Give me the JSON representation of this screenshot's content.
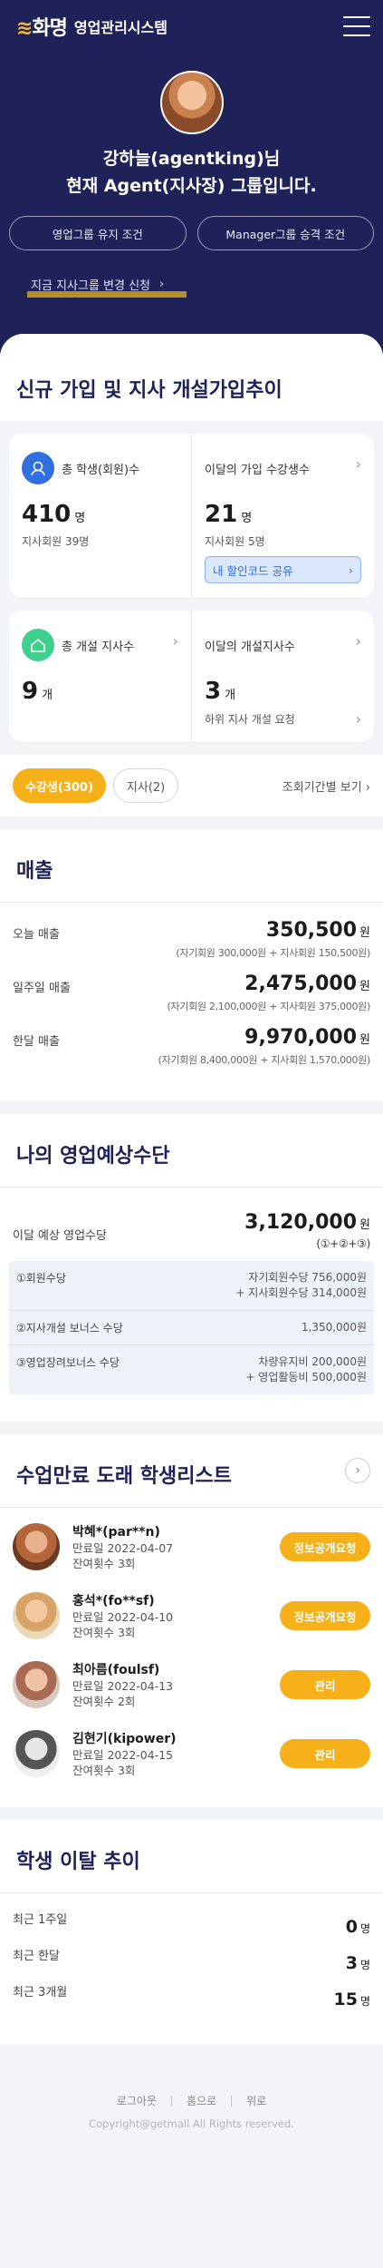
{
  "header": {
    "logo_text": "영업관리시스템",
    "logo_mark": "화명",
    "profile_name": "강하늘(agentking)님",
    "profile_group": "현재 Agent(지사장) 그룹입니다.",
    "btn_keep_condition": "영업그룹 유지 조건",
    "btn_manager_condition": "Manager그룹 승격 조건",
    "change_request": "지금 지사그룹 변경 신청"
  },
  "signup": {
    "title": "신규 가입 및 지사 개설가입추이",
    "total_students_label": "총 학생(회원)수",
    "total_students_value": "410",
    "total_students_unit": "명",
    "total_students_sub": "지사회원 39명",
    "month_join_label": "이달의 가입 수강생수",
    "month_join_value": "21",
    "month_join_unit": "명",
    "month_join_sub": "지사회원 5명",
    "share_btn": "내 할인코드 공유",
    "total_branch_label": "총 개설 지사수",
    "total_branch_value": "9",
    "total_branch_unit": "개",
    "month_branch_label": "이달의 개설지사수",
    "month_branch_value": "3",
    "month_branch_unit": "개",
    "month_branch_sub": "하위 지사 개설 요청",
    "filter_students": "수강생(300)",
    "filter_branch": "지사(2)",
    "period_link": "조회기간별 보기"
  },
  "sales": {
    "title": "매출",
    "rows": [
      {
        "label": "오늘 매출",
        "amount": "350,500",
        "unit": "원",
        "breakdown": "(자기회원 300,000원 + 지사회원 150,500원)"
      },
      {
        "label": "일주일 매출",
        "amount": "2,475,000",
        "unit": "원",
        "breakdown": "(자기회원 2,100,000원 + 지사회원 375,000원)"
      },
      {
        "label": "한달 매출",
        "amount": "9,970,000",
        "unit": "원",
        "breakdown": "(자기회원 8,400,000원 + 지사회원 1,570,000원)"
      }
    ]
  },
  "forecast": {
    "title": "나의 영업예상수단",
    "label": "이달 예상 영업수당",
    "amount": "3,120,000",
    "unit": "원",
    "formula": "(①+②+③)",
    "items": [
      {
        "label": "①회원수당",
        "value_line1": "자기회원수당 756,000원",
        "value_line2": "+ 지사회원수당 314,000원"
      },
      {
        "label": "②지사개설 보너스 수당",
        "value_line1": "1,350,000원",
        "value_line2": ""
      },
      {
        "label": "③영업장려보너스 수당",
        "value_line1": "차량유지비 200,000원",
        "value_line2": "+ 영업활동비 500,000원"
      }
    ]
  },
  "students": {
    "title": "수업만료 도래 학생리스트",
    "items": [
      {
        "name": "박혜*(par**n)",
        "expire": "만료일 2022-04-07",
        "remain": "잔여횟수 3회",
        "action": "정보공개요청",
        "color": "#c0703a"
      },
      {
        "name": "홍석*(fo**sf)",
        "expire": "만료일 2022-04-10",
        "remain": "잔여횟수 3회",
        "action": "정보공개요청",
        "color": "#d99a4a"
      },
      {
        "name": "최아름(foulsf)",
        "expire": "만료일 2022-04-13",
        "remain": "잔여횟수 2회",
        "action": "관리",
        "color": "#b57a62"
      },
      {
        "name": "김현기(kipower)",
        "expire": "만료일 2022-04-15",
        "remain": "잔여횟수 3회",
        "action": "관리",
        "color": "#888888"
      }
    ]
  },
  "churn": {
    "title": "학생 이탈 추이",
    "rows": [
      {
        "label": "최근 1주일",
        "value": "0",
        "unit": "명"
      },
      {
        "label": "최근 한달",
        "value": "3",
        "unit": "명"
      },
      {
        "label": "최근 3개월",
        "value": "15",
        "unit": "명"
      }
    ]
  },
  "footer": {
    "logout": "로그아웃",
    "home": "홈으로",
    "top": "위로",
    "copyright": "Copyright@getmall All Rights reserved."
  },
  "colors": {
    "navy": "#1f2258",
    "accent": "#f6b11a",
    "blue": "#2f6fe0",
    "green": "#3fcf8e"
  }
}
